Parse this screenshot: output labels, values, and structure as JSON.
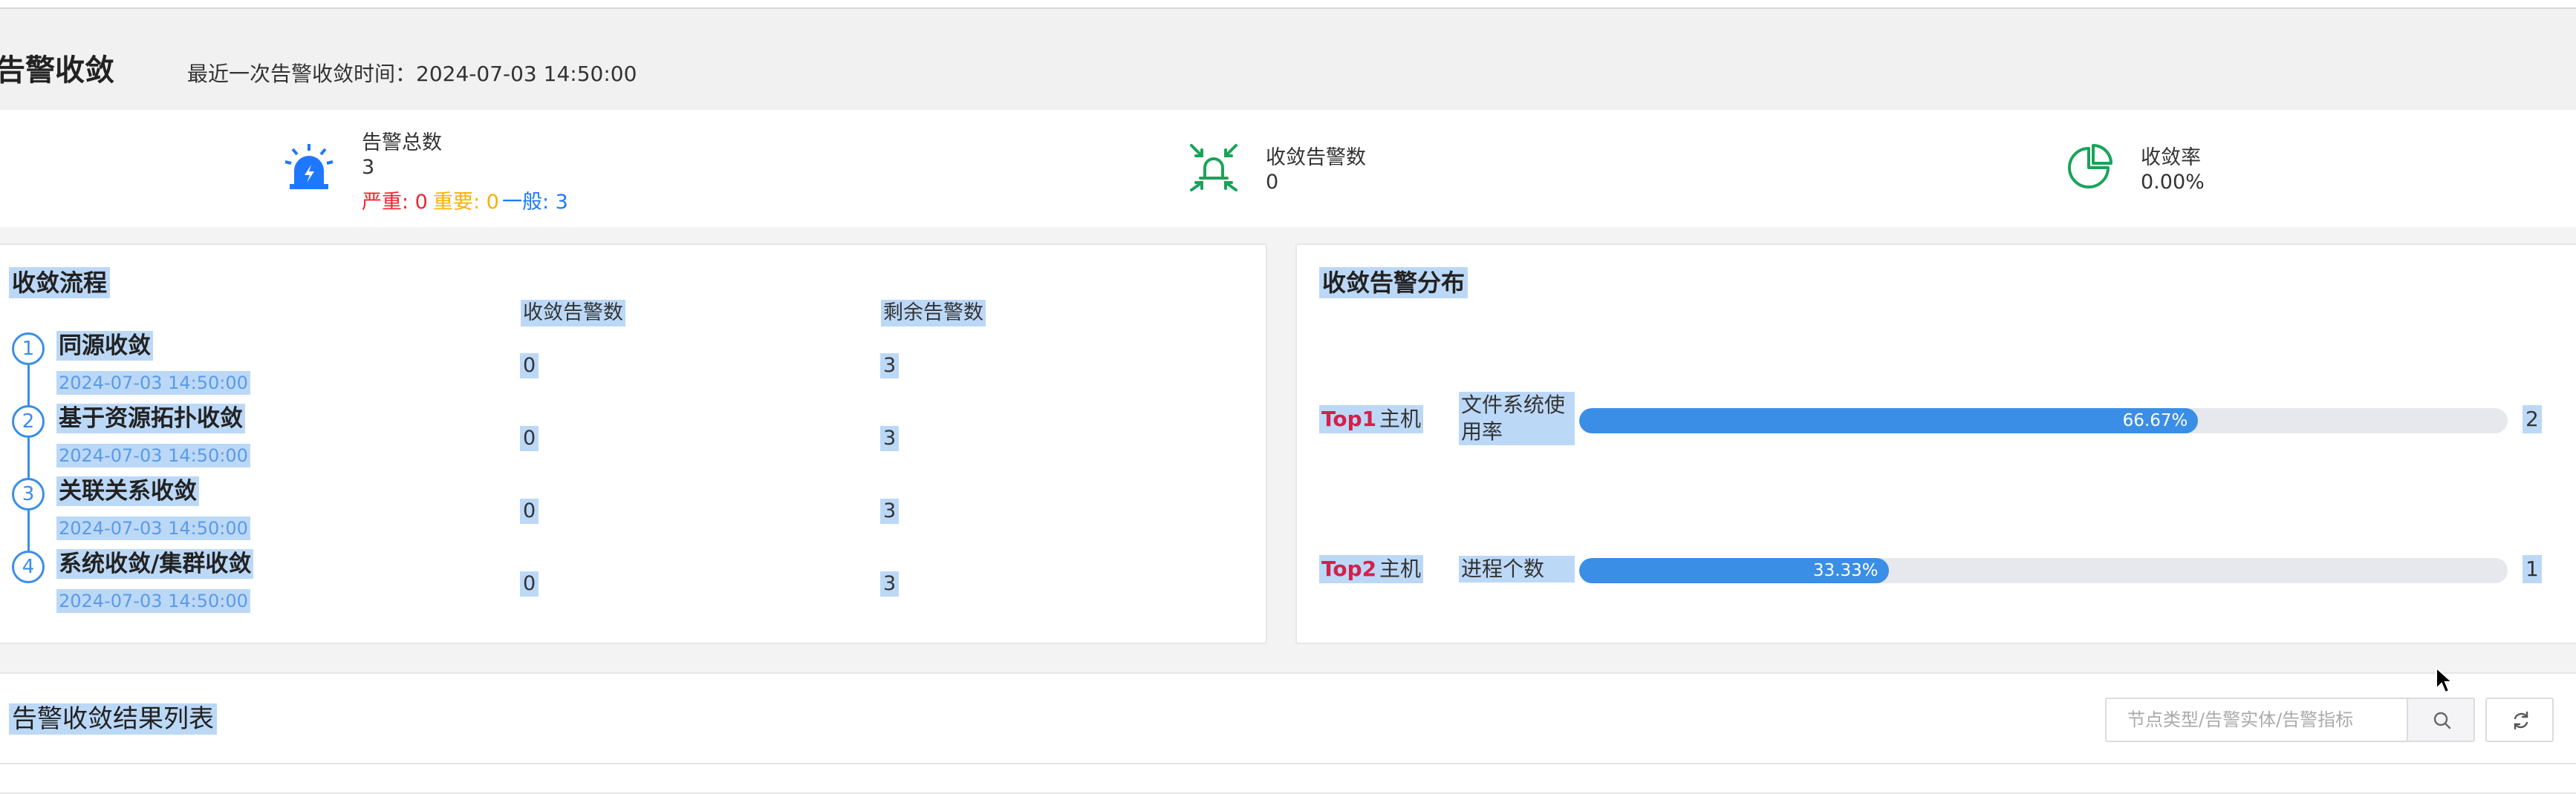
{
  "header": {
    "title": "告警收敛",
    "last_time_label": "最近一次告警收敛时间：",
    "last_time_value": "2024-07-03 14:50:00"
  },
  "stats": {
    "total": {
      "icon": "alarm-siren-icon",
      "label": "告警总数",
      "value": "3",
      "critical": "严重: 0",
      "major": "重要: 0",
      "minor": "一般: 3"
    },
    "converged": {
      "icon": "converge-alarm-icon",
      "label": "收敛告警数",
      "value": "0"
    },
    "rate": {
      "icon": "pie-rate-icon",
      "label": "收敛率",
      "value": "0.00%"
    }
  },
  "flow": {
    "title": "收敛流程",
    "col_converged": "收敛告警数",
    "col_remaining": "剩余告警数",
    "steps": [
      {
        "num": "1",
        "name": "同源收敛",
        "time": "2024-07-03 14:50:00",
        "converged": "0",
        "remaining": "3"
      },
      {
        "num": "2",
        "name": "基于资源拓扑收敛",
        "time": "2024-07-03 14:50:00",
        "converged": "0",
        "remaining": "3"
      },
      {
        "num": "3",
        "name": "关联关系收敛",
        "time": "2024-07-03 14:50:00",
        "converged": "0",
        "remaining": "3"
      },
      {
        "num": "4",
        "name": "系统收敛/集群收敛",
        "time": "2024-07-03 14:50:00",
        "converged": "0",
        "remaining": "3"
      }
    ]
  },
  "distribution": {
    "title": "收敛告警分布",
    "items": [
      {
        "rank": "Top1",
        "type": "主机",
        "metric": "文件系统使用率",
        "percent_label": "66.67%",
        "fraction": 0.6667,
        "count": "2"
      },
      {
        "rank": "Top2",
        "type": "主机",
        "metric": "进程个数",
        "percent_label": "33.33%",
        "fraction": 0.3333,
        "count": "1"
      }
    ]
  },
  "result_list": {
    "title": "告警收敛结果列表",
    "search_placeholder": "节点类型/告警实体/告警指标",
    "search_icon": "search-icon",
    "refresh_icon": "refresh-icon"
  },
  "colors": {
    "accent": "#3a8ee6",
    "critical": "#f5222d",
    "major": "#fab005",
    "minor": "#1e78ff",
    "converge_icon": "#1aa35a",
    "rank": "#d4204b"
  }
}
